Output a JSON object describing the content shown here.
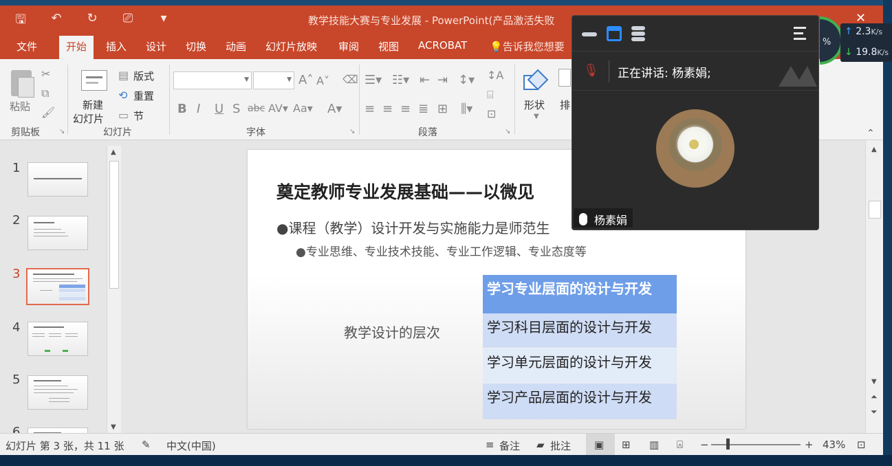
{
  "window": {
    "title": "教学技能大赛与专业发展 - PowerPoint(产品激活失败"
  },
  "tabs": [
    "文件",
    "开始",
    "插入",
    "设计",
    "切换",
    "动画",
    "幻灯片放映",
    "审阅",
    "视图",
    "ACROBAT"
  ],
  "active_tab": "开始",
  "tell_me": "告诉我您想要",
  "ribbon": {
    "paste": "粘贴",
    "new_slide_line1": "新建",
    "new_slide_line2": "幻灯片",
    "layout": "版式",
    "reset": "重置",
    "section": "节",
    "shapes": "形状",
    "arrange_partial": "排",
    "group_clipboard": "剪贴板",
    "group_slides": "幻灯片",
    "group_font": "字体",
    "group_paragraph": "段落"
  },
  "thumbnails": {
    "numbers": [
      "1",
      "2",
      "3",
      "4",
      "5",
      "6"
    ],
    "active": "3"
  },
  "slide": {
    "title": "奠定教师专业发展基础——以微见",
    "bullet1": "●课程（教学）设计开发与实施能力是师范生",
    "bullet2": "●专业思维、专业技术技能、专业工作逻辑、专业态度等",
    "layers_label": "教学设计的层次",
    "layers": [
      "学习专业层面的设计与开发",
      "学习科目层面的设计与开发",
      "学习单元层面的设计与开发",
      "学习产品层面的设计与开发"
    ]
  },
  "status": {
    "slide_info": "幻灯片 第 3 张，共 11 张",
    "language": "中文(中国)",
    "notes": "备注",
    "comments": "批注",
    "zoom": "43%"
  },
  "meeting": {
    "speaking_label": "正在讲话:  杨素娟;",
    "participant_name": "杨素娟"
  },
  "netspeed": {
    "percent": "%",
    "up": "2.3",
    "down": "19.8",
    "unit": "K/s"
  },
  "colors": {
    "ppt_accent": "#c8462a",
    "layer_highlight": "#6f9ee8",
    "layer_light": "#cfdcf5",
    "meeting_bg": "#2b2b2b",
    "meeting_blue": "#2d8cff"
  }
}
